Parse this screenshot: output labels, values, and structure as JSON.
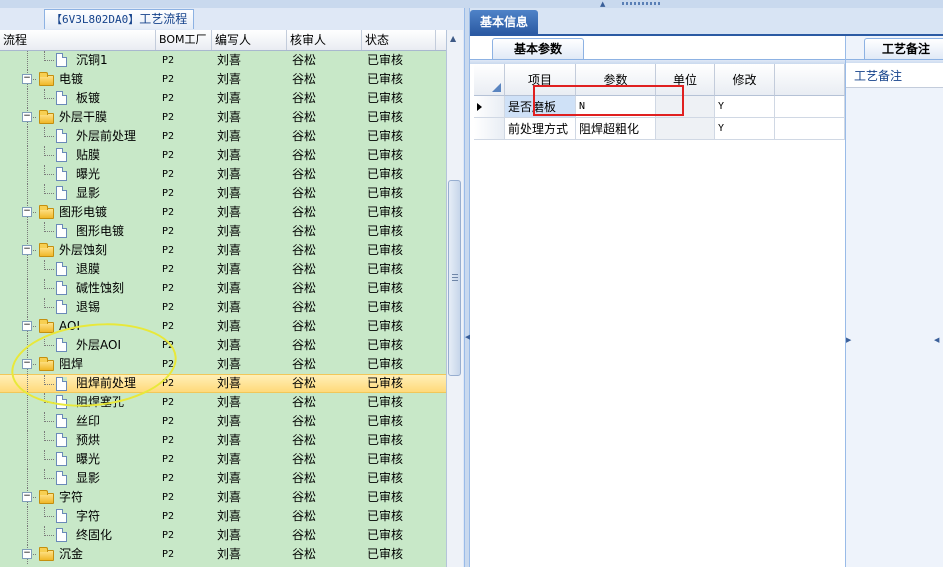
{
  "left_panel": {
    "title_code": "【6V3L802DA0】",
    "title_text": "工艺流程",
    "columns": {
      "flow": "流程",
      "bom": "BOM工厂",
      "author": "编写人",
      "reviewer": "核审人",
      "status": "状态"
    },
    "rows": [
      {
        "name": "沉铜1",
        "type": "doc",
        "level": 2,
        "bom": "P2",
        "author": "刘喜",
        "reviewer": "谷松",
        "status": "已审核"
      },
      {
        "name": "电镀",
        "type": "folder",
        "level": 1,
        "bom": "P2",
        "author": "刘喜",
        "reviewer": "谷松",
        "status": "已审核"
      },
      {
        "name": "板镀",
        "type": "doc",
        "level": 2,
        "bom": "P2",
        "author": "刘喜",
        "reviewer": "谷松",
        "status": "已审核"
      },
      {
        "name": "外层干膜",
        "type": "folder",
        "level": 1,
        "bom": "P2",
        "author": "刘喜",
        "reviewer": "谷松",
        "status": "已审核"
      },
      {
        "name": "外层前处理",
        "type": "doc",
        "level": 2,
        "bom": "P2",
        "author": "刘喜",
        "reviewer": "谷松",
        "status": "已审核"
      },
      {
        "name": "贴膜",
        "type": "doc",
        "level": 2,
        "bom": "P2",
        "author": "刘喜",
        "reviewer": "谷松",
        "status": "已审核"
      },
      {
        "name": "曝光",
        "type": "doc",
        "level": 2,
        "bom": "P2",
        "author": "刘喜",
        "reviewer": "谷松",
        "status": "已审核"
      },
      {
        "name": "显影",
        "type": "doc",
        "level": 2,
        "bom": "P2",
        "author": "刘喜",
        "reviewer": "谷松",
        "status": "已审核"
      },
      {
        "name": "图形电镀",
        "type": "folder",
        "level": 1,
        "bom": "P2",
        "author": "刘喜",
        "reviewer": "谷松",
        "status": "已审核"
      },
      {
        "name": "图形电镀",
        "type": "doc",
        "level": 2,
        "bom": "P2",
        "author": "刘喜",
        "reviewer": "谷松",
        "status": "已审核"
      },
      {
        "name": "外层蚀刻",
        "type": "folder",
        "level": 1,
        "bom": "P2",
        "author": "刘喜",
        "reviewer": "谷松",
        "status": "已审核"
      },
      {
        "name": "退膜",
        "type": "doc",
        "level": 2,
        "bom": "P2",
        "author": "刘喜",
        "reviewer": "谷松",
        "status": "已审核"
      },
      {
        "name": "碱性蚀刻",
        "type": "doc",
        "level": 2,
        "bom": "P2",
        "author": "刘喜",
        "reviewer": "谷松",
        "status": "已审核"
      },
      {
        "name": "退锡",
        "type": "doc",
        "level": 2,
        "bom": "P2",
        "author": "刘喜",
        "reviewer": "谷松",
        "status": "已审核"
      },
      {
        "name": "AOI",
        "type": "folder",
        "level": 1,
        "bom": "P2",
        "author": "刘喜",
        "reviewer": "谷松",
        "status": "已审核"
      },
      {
        "name": "外层AOI",
        "type": "doc",
        "level": 2,
        "bom": "P2",
        "author": "刘喜",
        "reviewer": "谷松",
        "status": "已审核"
      },
      {
        "name": "阻焊",
        "type": "folder",
        "level": 1,
        "bom": "P2",
        "author": "刘喜",
        "reviewer": "谷松",
        "status": "已审核"
      },
      {
        "name": "阻焊前处理",
        "type": "doc",
        "level": 2,
        "bom": "P2",
        "author": "刘喜",
        "reviewer": "谷松",
        "status": "已审核",
        "selected": true
      },
      {
        "name": "阻焊塞孔",
        "type": "doc",
        "level": 2,
        "bom": "P2",
        "author": "刘喜",
        "reviewer": "谷松",
        "status": "已审核"
      },
      {
        "name": "丝印",
        "type": "doc",
        "level": 2,
        "bom": "P2",
        "author": "刘喜",
        "reviewer": "谷松",
        "status": "已审核"
      },
      {
        "name": "预烘",
        "type": "doc",
        "level": 2,
        "bom": "P2",
        "author": "刘喜",
        "reviewer": "谷松",
        "status": "已审核"
      },
      {
        "name": "曝光",
        "type": "doc",
        "level": 2,
        "bom": "P2",
        "author": "刘喜",
        "reviewer": "谷松",
        "status": "已审核"
      },
      {
        "name": "显影",
        "type": "doc",
        "level": 2,
        "bom": "P2",
        "author": "刘喜",
        "reviewer": "谷松",
        "status": "已审核"
      },
      {
        "name": "字符",
        "type": "folder",
        "level": 1,
        "bom": "P2",
        "author": "刘喜",
        "reviewer": "谷松",
        "status": "已审核"
      },
      {
        "name": "字符",
        "type": "doc",
        "level": 2,
        "bom": "P2",
        "author": "刘喜",
        "reviewer": "谷松",
        "status": "已审核"
      },
      {
        "name": "终固化",
        "type": "doc",
        "level": 2,
        "bom": "P2",
        "author": "刘喜",
        "reviewer": "谷松",
        "status": "已审核"
      },
      {
        "name": "沉金",
        "type": "folder",
        "level": 1,
        "bom": "P2",
        "author": "刘喜",
        "reviewer": "谷松",
        "status": "已审核"
      }
    ]
  },
  "right_panel": {
    "main_tab": "基本信息",
    "params_tab": "基本参数",
    "notes_tab": "工艺备注",
    "notes_label": "工艺备注",
    "params_columns": {
      "item": "项目",
      "param": "参数",
      "unit": "单位",
      "modify": "修改"
    },
    "params_rows": [
      {
        "item": "是否磨板",
        "param": "N",
        "unit": "",
        "modify": "Y",
        "current": true
      },
      {
        "item": "前处理方式",
        "param": "阻焊超粗化",
        "unit": "",
        "modify": "Y",
        "current": false
      }
    ]
  },
  "colors": {
    "tree_bg": "#c8e8c8",
    "selected_row": "#ffd97a",
    "highlight_box": "#e02020",
    "annotation_ellipse": "#e8e83a",
    "tab_active": "#2b5aa3"
  }
}
